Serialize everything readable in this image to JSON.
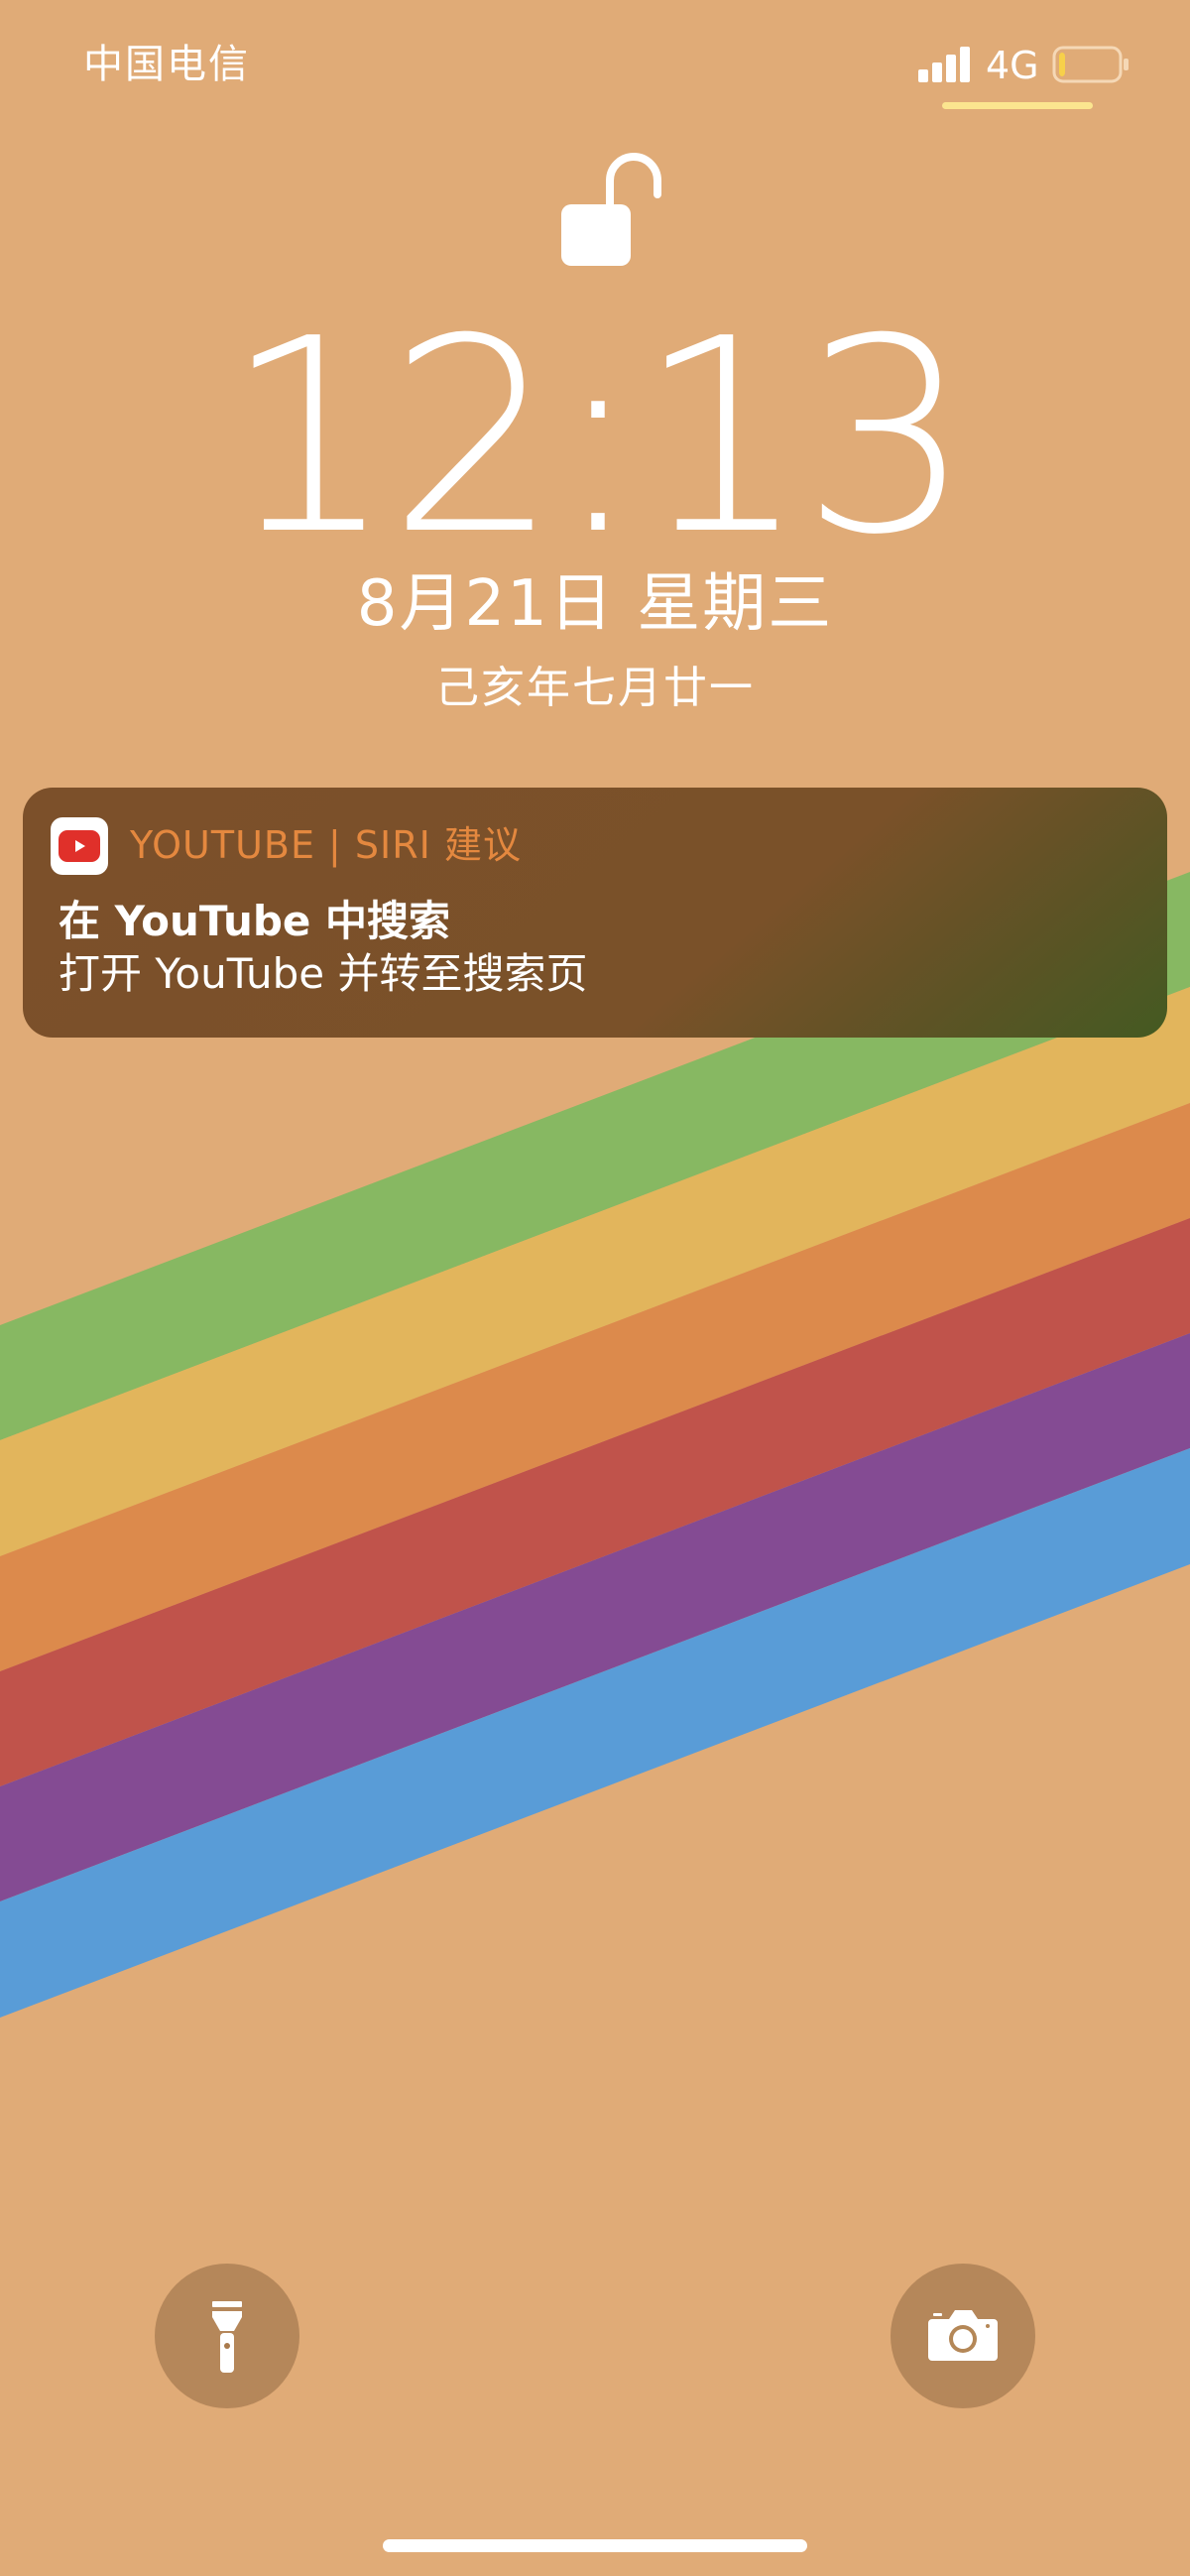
{
  "status_bar": {
    "carrier": "中国电信",
    "network": "4G",
    "signal_bars": 4,
    "battery_fraction": 0.1
  },
  "lock_screen": {
    "time": "12:13",
    "date": "8月21日 星期三",
    "lunar_date": "己亥年七月廿一"
  },
  "notification": {
    "app_icon": "youtube-icon",
    "source": "YOUTUBE | SIRI 建议",
    "title": "在 YouTube 中搜索",
    "body": "打开 YouTube 并转至搜索页"
  },
  "quick_actions": {
    "left_icon": "flashlight-icon",
    "right_icon": "camera-icon"
  },
  "colors": {
    "background": "#e0ab77",
    "notification_source": "#e4883f",
    "status_underline": "#fbe58f",
    "stripes": [
      "#87b862",
      "#e2b55c",
      "#dc8a4c",
      "#c0534b",
      "#844b93",
      "#599cd7"
    ]
  }
}
